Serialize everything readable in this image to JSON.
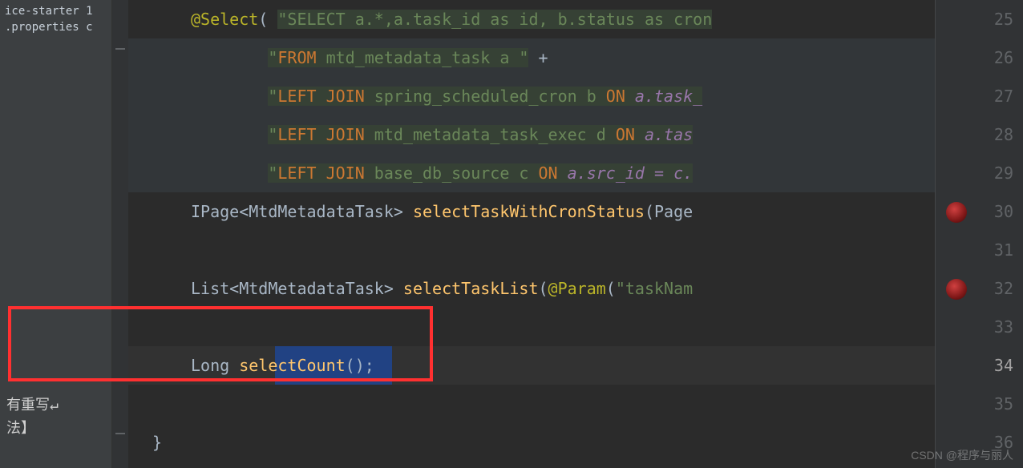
{
  "sidebar": {
    "items": [
      {
        "label": "ice-starter 1"
      },
      {
        "label": ".properties c"
      }
    ]
  },
  "bottomText": {
    "line1": "有重写↵",
    "line2": "法】"
  },
  "gutter": {
    "start": 25,
    "lines": [
      "25",
      "26",
      "27",
      "28",
      "29",
      "30",
      "31",
      "32",
      "33",
      "34",
      "35",
      "36"
    ]
  },
  "code": {
    "line25": {
      "prefix": "@Select",
      "paren": "( ",
      "sql": "\"SELECT a.*,a.task_id as id, b.status as cron"
    },
    "line26": {
      "quote": "\"",
      "kw": "FROM",
      "rest": " mtd_metadata_task a ",
      "quote2": "\"",
      "plus": " +"
    },
    "line27": {
      "quote": "\"",
      "kw": "LEFT JOIN",
      "rest": " spring_scheduled_cron b ",
      "on": "ON",
      "tail": " a.task_"
    },
    "line28": {
      "quote": "\"",
      "kw": "LEFT JOIN",
      "rest": " mtd_metadata_task_exec d ",
      "on": "ON",
      "tail": " a.tas"
    },
    "line29": {
      "quote": "\"",
      "kw": "LEFT JOIN",
      "rest": " base_db_source c ",
      "on": "ON",
      "tail": " a.src_id = c."
    },
    "line30": {
      "type1": "IPage",
      "generic": "<MtdMetadataTask>",
      "method": " selectTaskWithCronStatus",
      "params": "(Page"
    },
    "line32": {
      "type1": "List",
      "generic": "<MtdMetadataTask>",
      "method": " selectTaskList",
      "paren": "(",
      "anno": "@Param",
      "paren2": "(",
      "str": "\"taskNam"
    },
    "line34": {
      "type": "Long ",
      "method": "selectCount",
      "tail": "();"
    },
    "line36": {
      "brace": "}"
    }
  },
  "watermark": "CSDN @程序与丽人"
}
